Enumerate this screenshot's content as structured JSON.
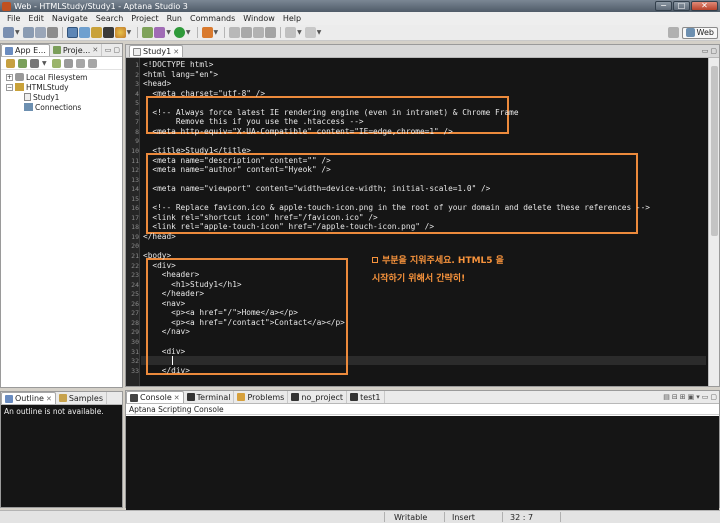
{
  "window": {
    "title": "Web - HTMLStudy/Study1 - Aptana Studio 3",
    "controls": [
      "−",
      "□",
      "✕"
    ]
  },
  "menu": [
    "File",
    "Edit",
    "Navigate",
    "Search",
    "Project",
    "Run",
    "Commands",
    "Window",
    "Help"
  ],
  "perspective": {
    "label": "Web"
  },
  "explorer": {
    "tabs": [
      "App E...",
      "Proje..."
    ],
    "tree": [
      {
        "label": "Local Filesystem",
        "level": 0,
        "expanded": false,
        "icon": "drive-icon"
      },
      {
        "label": "HTMLStudy",
        "level": 0,
        "expanded": true,
        "icon": "project-icon"
      },
      {
        "label": "Study1",
        "level": 1,
        "icon": "file-icon"
      },
      {
        "label": "Connections",
        "level": 1,
        "icon": "connections-icon"
      }
    ]
  },
  "outline": {
    "tabs": [
      "Outline",
      "Samples"
    ],
    "message": "An outline is not available."
  },
  "editor": {
    "tab": "Study1",
    "code_lines": [
      "<!DOCTYPE html>",
      "<html lang=\"en\">",
      "<head>",
      "  <meta charset=\"utf-8\" />",
      "",
      "  <!-- Always force latest IE rendering engine (even in intranet) & Chrome Frame",
      "       Remove this if you use the .htaccess -->",
      "  <meta http-equiv=\"X-UA-Compatible\" content=\"IE=edge,chrome=1\" />",
      "",
      "  <title>Study1</title>",
      "  <meta name=\"description\" content=\"\" />",
      "  <meta name=\"author\" content=\"Hyeok\" />",
      "",
      "  <meta name=\"viewport\" content=\"width=device-width; initial-scale=1.0\" />",
      "",
      "  <!-- Replace favicon.ico & apple-touch-icon.png in the root of your domain and delete these references -->",
      "  <link rel=\"shortcut icon\" href=\"/favicon.ico\" />",
      "  <link rel=\"apple-touch-icon\" href=\"/apple-touch-icon.png\" />",
      "</head>",
      "",
      "<body>",
      "  <div>",
      "    <header>",
      "      <h1>Study1</h1>",
      "    </header>",
      "    <nav>",
      "      <p><a href=\"/\">Home</a></p>",
      "      <p><a href=\"/contact\">Contact</a></p>",
      "    </nav>",
      "",
      "    <div>",
      "      ",
      "    </div>"
    ],
    "annotation_line1": "부분을 지워주세요. HTML5 을",
    "annotation_line2": "시작하기 위해서 간략히!"
  },
  "console": {
    "tabs": [
      "Console",
      "Terminal",
      "Problems",
      "no_project",
      "test1"
    ],
    "subtitle": "Aptana Scripting Console"
  },
  "status": {
    "mode": "Writable",
    "insert": "Insert",
    "position": "32 : 7"
  },
  "colors": {
    "highlight": "#ec8a3c",
    "editor_bg": "#151515"
  }
}
